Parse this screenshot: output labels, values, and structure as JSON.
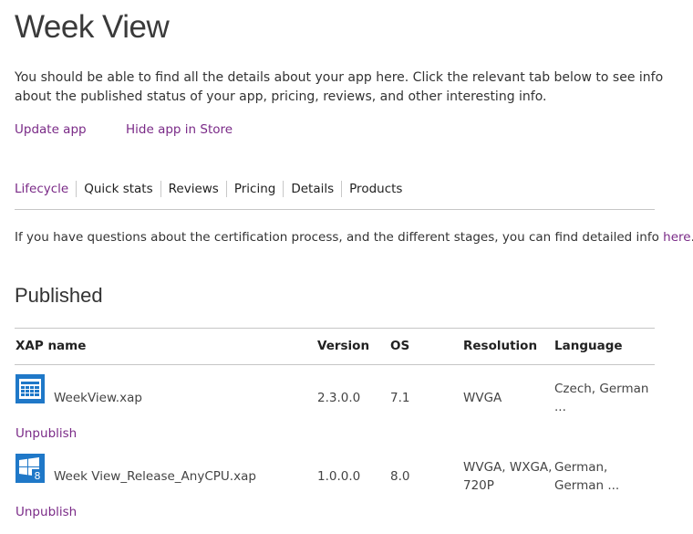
{
  "page": {
    "title": "Week View",
    "intro_line1": "You should be able to find all the details about your app here. Click the relevant tab below to see info",
    "intro_line2": "about the published status of your app, pricing, reviews, and other interesting info."
  },
  "actions": {
    "update": "Update app",
    "hide": "Hide app in Store"
  },
  "tabs": [
    "Lifecycle",
    "Quick stats",
    "Reviews",
    "Pricing",
    "Details",
    "Products"
  ],
  "info": {
    "text": "If you have questions about the certification process, and the different stages, you can find detailed info ",
    "link": "here",
    "end": "."
  },
  "published": {
    "heading": "Published",
    "columns": {
      "xap": "XAP name",
      "version": "Version",
      "os": "OS",
      "resolution": "Resolution",
      "language": "Language"
    },
    "rows": [
      {
        "icon": "week-calendar-icon",
        "name": "WeekView.xap",
        "version": "2.3.0.0",
        "os": "7.1",
        "resolution_1": "WVGA",
        "resolution_2": "",
        "language_1": "Czech, German",
        "language_2": "...",
        "action": "Unpublish"
      },
      {
        "icon": "windows-8-icon",
        "name": "Week View_Release_AnyCPU.xap",
        "version": "1.0.0.0",
        "os": "8.0",
        "resolution_1": "WVGA, WXGA,",
        "resolution_2": "720P",
        "language_1": "German,",
        "language_2": "German ...",
        "action": "Unpublish"
      }
    ]
  },
  "colors": {
    "link": "#7a2a87",
    "icon_blue": "#1f78c8",
    "rule": "#c6c6c6"
  }
}
